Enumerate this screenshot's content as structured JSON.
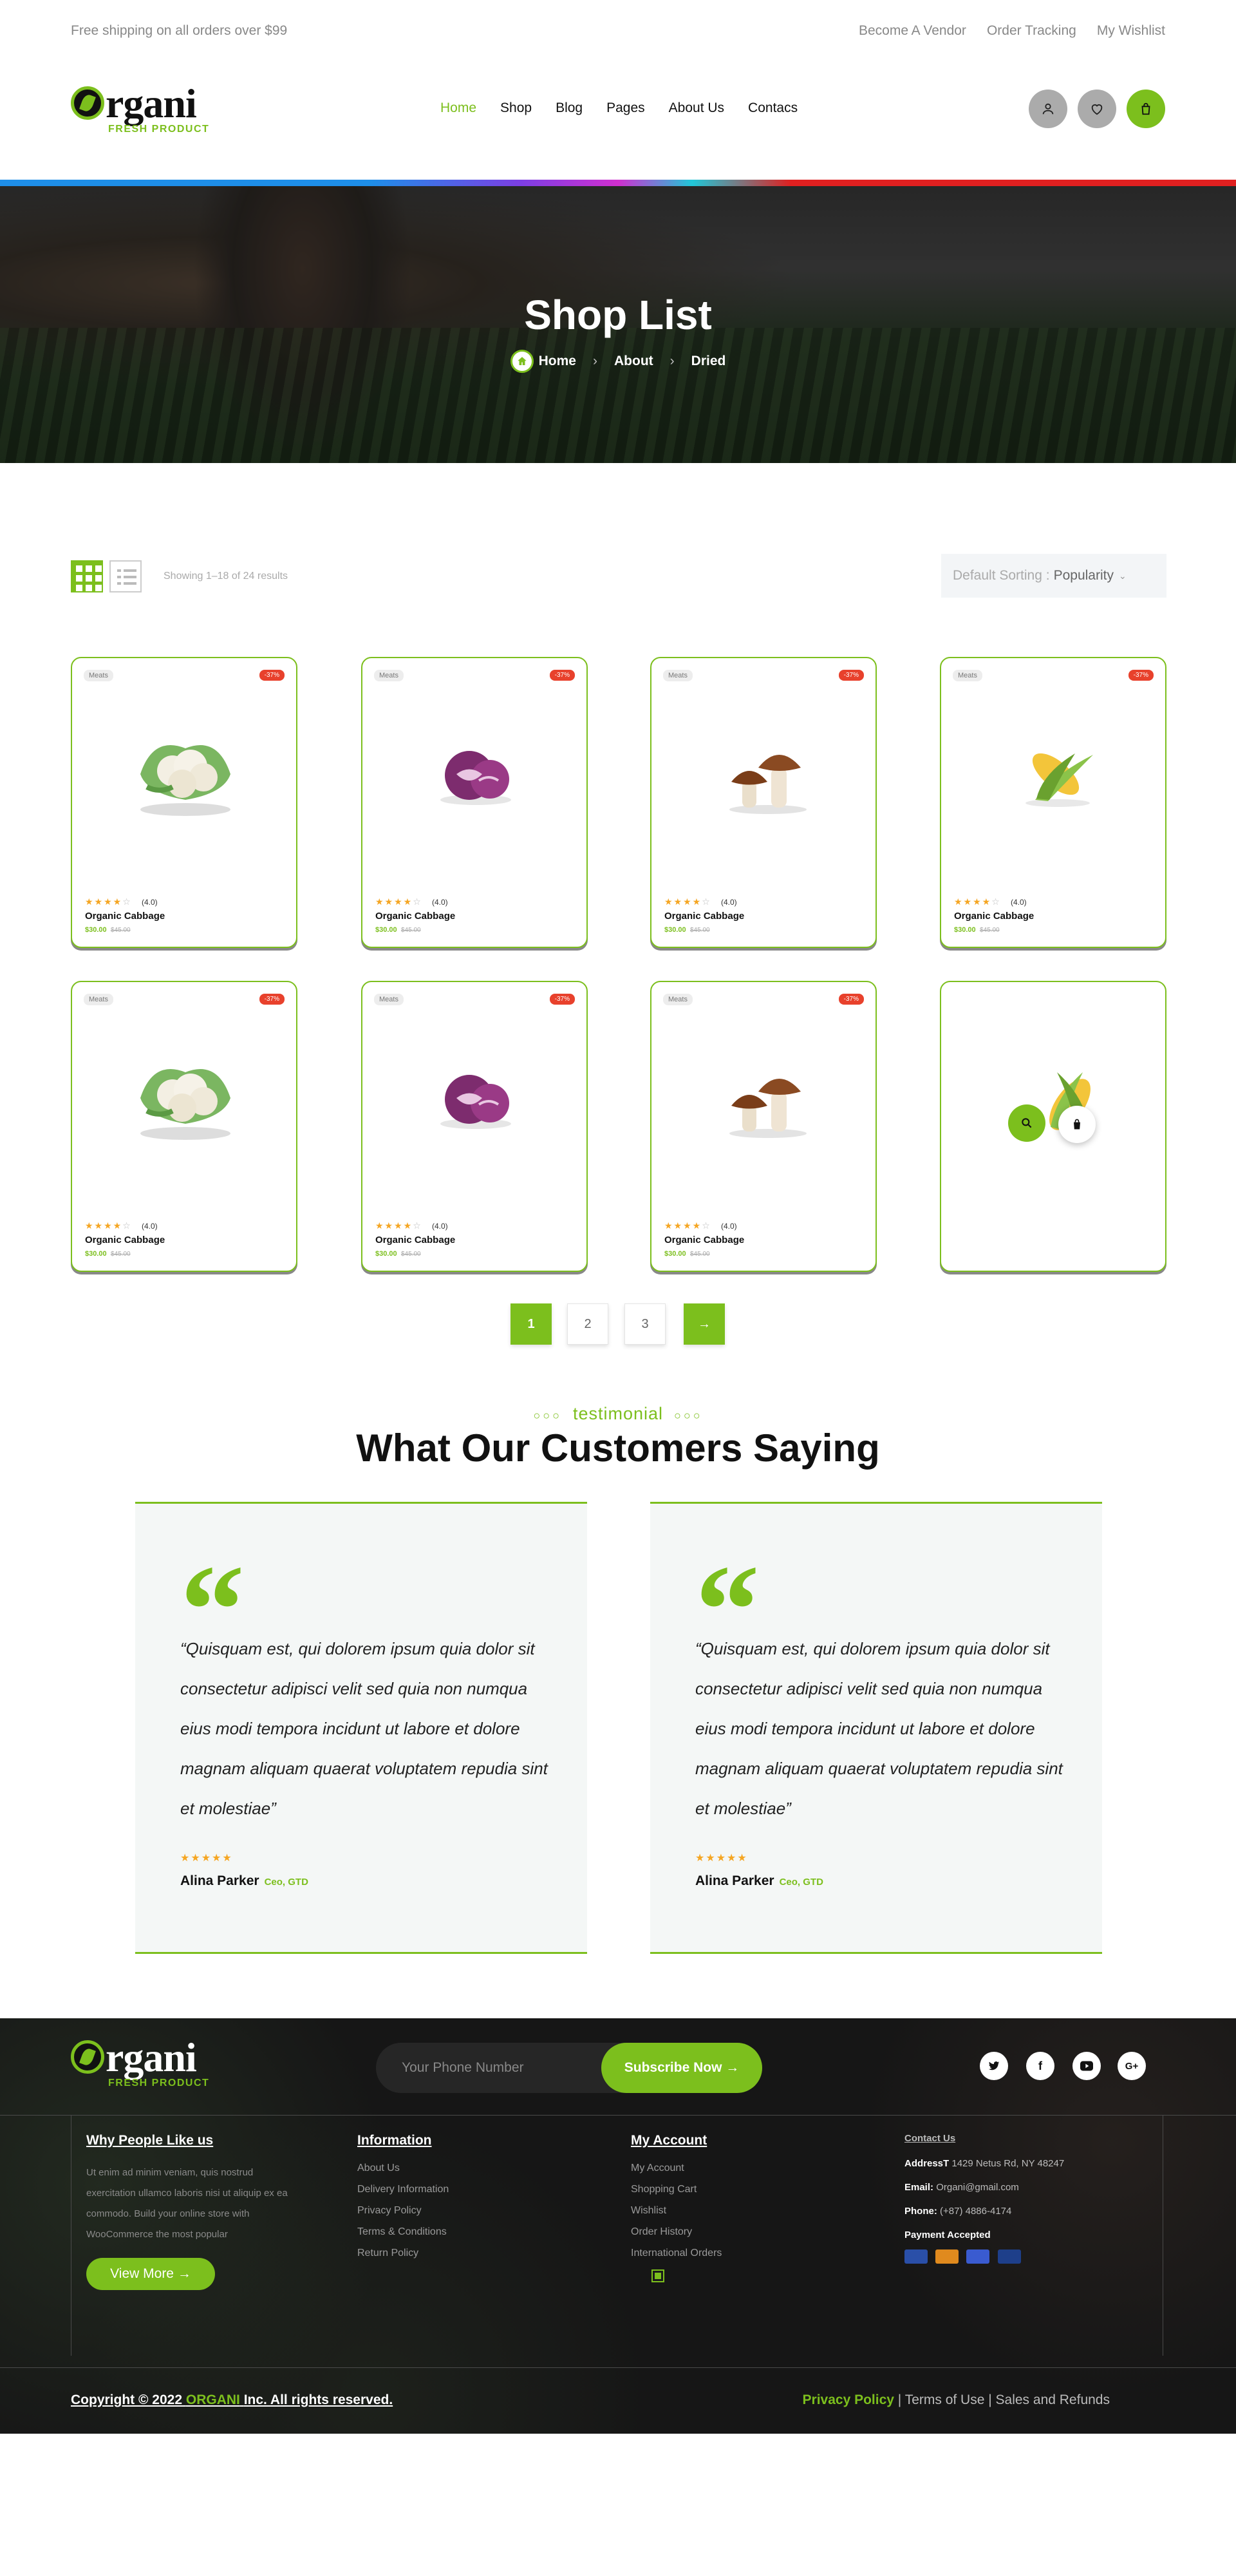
{
  "topbar": {
    "shipping": "Free shipping on all orders over $99",
    "links": [
      "Become A Vendor",
      "Order Tracking",
      "My Wishlist"
    ]
  },
  "logo": {
    "word": "rgani",
    "tagline": "FRESH PRODUCT"
  },
  "nav": [
    "Home",
    "Shop",
    "Blog",
    "Pages",
    "About Us",
    "Contacs"
  ],
  "hero": {
    "title": "Shop List",
    "breadcrumb": [
      "Home",
      "About",
      "Dried"
    ]
  },
  "toolbar": {
    "showing": "Showing 1–18 of 24 results",
    "sort_label": "Default Sorting :",
    "sort_value": "Popularity"
  },
  "products": [
    {
      "category": "Meats",
      "discount": "-37%",
      "rating": "(4.0)",
      "name": "Organic Cabbage",
      "price": "$30.00",
      "old_price": "$45.00",
      "image": "cauliflower"
    },
    {
      "category": "Meats",
      "discount": "-37%",
      "rating": "(4.0)",
      "name": "Organic Cabbage",
      "price": "$30.00",
      "old_price": "$45.00",
      "image": "red-cabbage"
    },
    {
      "category": "Meats",
      "discount": "-37%",
      "rating": "(4.0)",
      "name": "Organic Cabbage",
      "price": "$30.00",
      "old_price": "$45.00",
      "image": "mushroom"
    },
    {
      "category": "Meats",
      "discount": "-37%",
      "rating": "(4.0)",
      "name": "Organic Cabbage",
      "price": "$30.00",
      "old_price": "$45.00",
      "image": "corn"
    },
    {
      "category": "Meats",
      "discount": "-37%",
      "rating": "(4.0)",
      "name": "Organic Cabbage",
      "price": "$30.00",
      "old_price": "$45.00",
      "image": "cauliflower"
    },
    {
      "category": "Meats",
      "discount": "-37%",
      "rating": "(4.0)",
      "name": "Organic Cabbage",
      "price": "$30.00",
      "old_price": "$45.00",
      "image": "red-cabbage"
    },
    {
      "category": "Meats",
      "discount": "-37%",
      "rating": "(4.0)",
      "name": "Organic Cabbage",
      "price": "$30.00",
      "old_price": "$45.00",
      "image": "mushroom"
    }
  ],
  "pagination": {
    "pages": [
      "1",
      "2",
      "3"
    ],
    "current": "1",
    "next": "→"
  },
  "testimonial": {
    "eyebrow": "testimonial",
    "title": "What Our Customers Saying",
    "items": [
      {
        "quote": "“Quisquam est, qui dolorem ipsum quia dolor sit consectetur adipisci velit sed quia non numqua eius modi tempora incidunt ut labore et dolore magnam aliquam quaerat voluptatem repudia sint et molestiae”",
        "name": "Alina Parker",
        "role": "Ceo, GTD"
      },
      {
        "quote": "“Quisquam est, qui dolorem ipsum quia dolor sit consectetur adipisci velit sed quia non numqua eius modi tempora incidunt ut labore et dolore magnam aliquam quaerat voluptatem repudia sint et molestiae”",
        "name": "Alina Parker",
        "role": "Ceo, GTD"
      }
    ]
  },
  "footer": {
    "phone_placeholder": "Your Phone Number",
    "subscribe": "Subscribe Now →",
    "col1": {
      "title": "Why People Like us",
      "desc": "Ut enim ad minim veniam, quis nostrud exercitation ullamco laboris nisi ut aliquip ex ea commodo. Build your online store with WooCommerce the most popular",
      "button": "View More →"
    },
    "col2": {
      "title": "Information",
      "items": [
        "About Us",
        "Delivery Information",
        "Privacy Policy",
        "Terms & Conditions",
        "Return Policy"
      ]
    },
    "col3": {
      "title": "My Account",
      "items": [
        "My Account",
        "Shopping Cart",
        "Wishlist",
        "Order History",
        "International Orders"
      ]
    },
    "col4": {
      "title": "Contact Us",
      "address_label": "AddressT",
      "address": "1429 Netus Rd, NY 48247",
      "email_label": "Email:",
      "email": "Organi@gmail.com",
      "phone_label": "Phone:",
      "phone": "(+87) 4886-4174",
      "payment": "Payment Accepted"
    },
    "copyright_pre": "Copyright © 2022",
    "copyright_brand": "ORGANI",
    "copyright_post": "Inc. All rights reserved.",
    "links": [
      "Privacy Policy",
      "Terms of Use",
      "Sales and Refunds"
    ]
  },
  "colors": {
    "brand": "#7cbf1d",
    "sale": "#e8412c",
    "star": "#f5a623"
  }
}
